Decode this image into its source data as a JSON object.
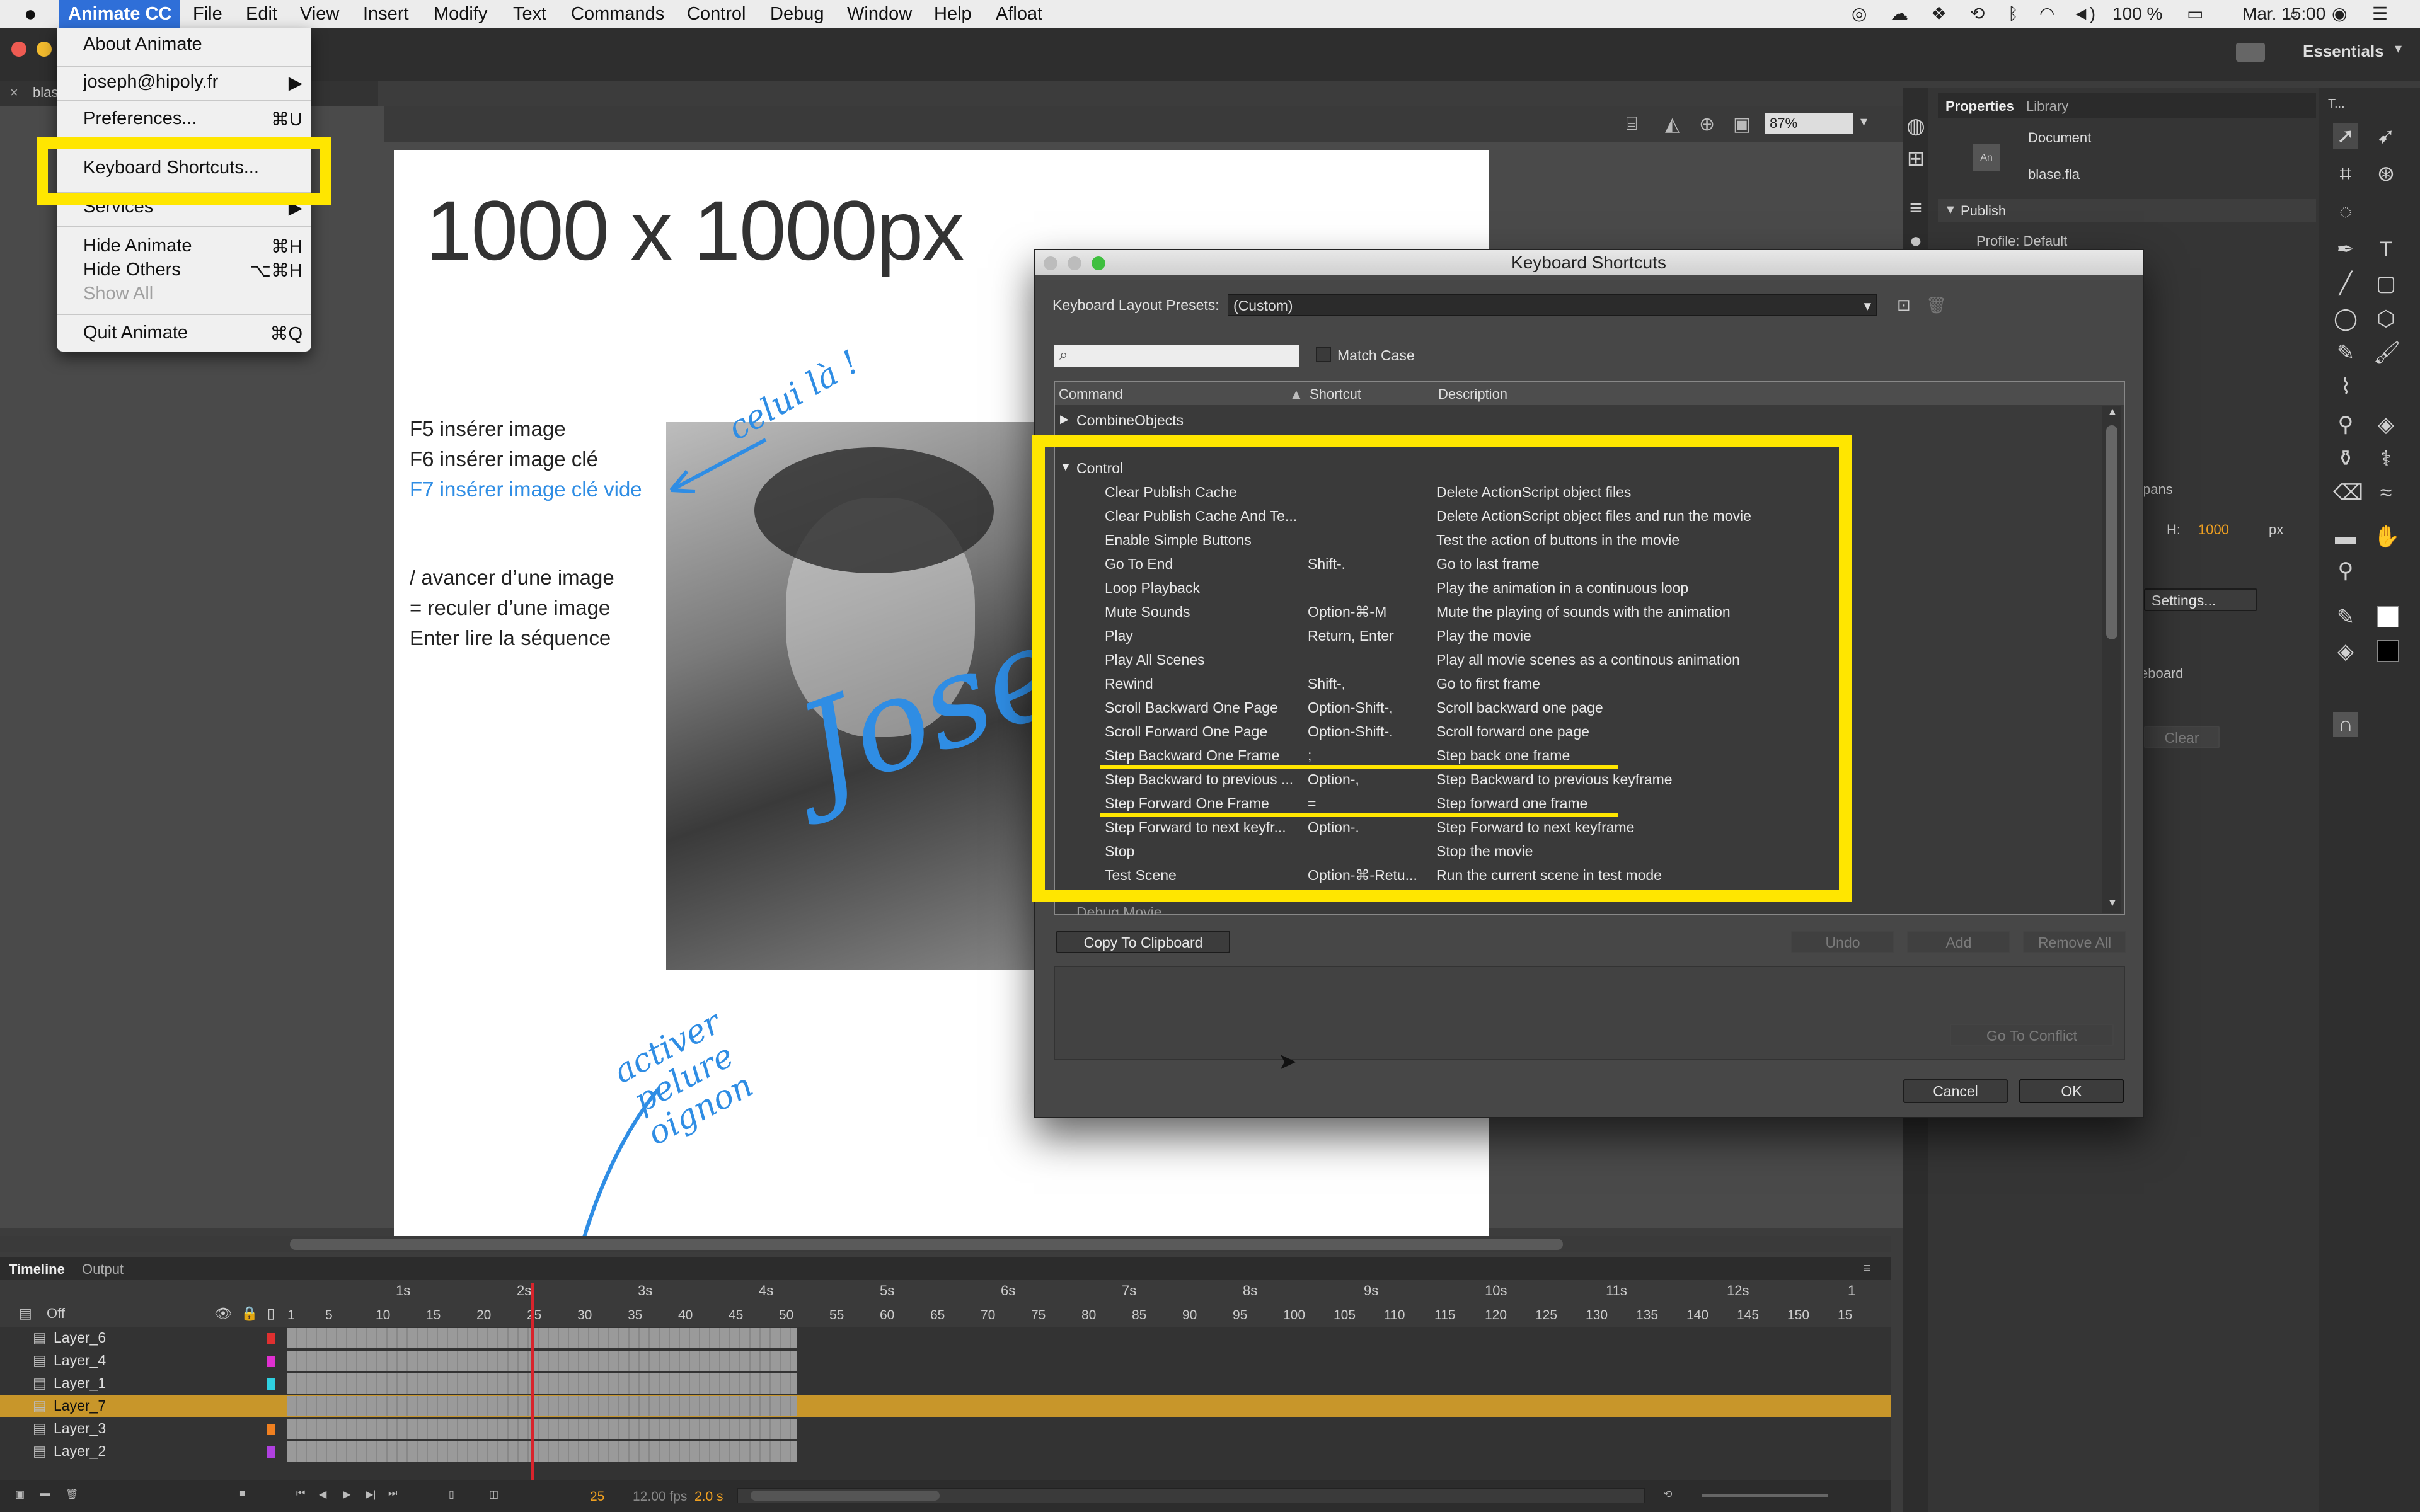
{
  "menubar": {
    "app": "Animate CC",
    "items": [
      "File",
      "Edit",
      "View",
      "Insert",
      "Modify",
      "Text",
      "Commands",
      "Control",
      "Debug",
      "Window",
      "Help",
      "Afloat"
    ],
    "battery": "100 %",
    "clock": "Mar. 15:00"
  },
  "app_menu": {
    "about": "About Animate",
    "account": "joseph@hipoly.fr",
    "preferences": "Preferences...",
    "preferences_key": "⌘U",
    "keyboard_shortcuts": "Keyboard Shortcuts...",
    "services": "Services",
    "hide": "Hide Animate",
    "hide_key": "⌘H",
    "hide_others": "Hide Others",
    "hide_others_key": "⌥⌘H",
    "show_all": "Show All",
    "quit": "Quit Animate",
    "quit_key": "⌘Q"
  },
  "toolbar": {
    "workspace": "Essentials",
    "zoom": "87%",
    "doc_tab": "blas"
  },
  "canvas": {
    "title": "1000 x 1000px",
    "notes": [
      "F5 insérer image",
      "F6 insérer image clé",
      "F7 insérer image clé vide"
    ],
    "notes2": [
      "/ avancer d’une image",
      "= reculer d’une image",
      "Enter lire la séquence"
    ],
    "handwriting_1": "celui là !",
    "handwriting_2": "activer pelure oignon",
    "signature": "Josef"
  },
  "properties": {
    "tabs": [
      "Properties",
      "Library"
    ],
    "doc_type": "Document",
    "file": "blase.fla",
    "section": "Publish",
    "profile": "Profile: Default",
    "h_label": "H:",
    "h_value": "1000",
    "unit": "px",
    "settings": "Settings...",
    "clear": "Clear",
    "partial_1": "pans",
    "partial_2": "eboard"
  },
  "dialog": {
    "title": "Keyboard Shortcuts",
    "preset_label": "Keyboard Layout Presets:",
    "preset_value": "(Custom)",
    "match_case": "Match Case",
    "col_command": "Command",
    "col_shortcut": "Shortcut",
    "col_description": "Description",
    "group_collapsed": "CombineObjects",
    "group_open": "Control",
    "rows": [
      {
        "command": "Clear Publish Cache",
        "shortcut": "",
        "description": "Delete ActionScript object files"
      },
      {
        "command": "Clear Publish Cache And Te...",
        "shortcut": "",
        "description": "Delete ActionScript object files and run the movie"
      },
      {
        "command": "Enable Simple Buttons",
        "shortcut": "",
        "description": "Test the action of buttons in the movie"
      },
      {
        "command": "Go To End",
        "shortcut": "Shift-.",
        "description": "Go to last frame"
      },
      {
        "command": "Loop Playback",
        "shortcut": "",
        "description": "Play the animation in a continuous loop"
      },
      {
        "command": "Mute Sounds",
        "shortcut": "Option-⌘-M",
        "description": "Mute the playing of sounds with the animation"
      },
      {
        "command": "Play",
        "shortcut": "Return, Enter",
        "description": "Play the movie"
      },
      {
        "command": "Play All Scenes",
        "shortcut": "",
        "description": "Play all movie scenes as a continous animation"
      },
      {
        "command": "Rewind",
        "shortcut": "Shift-,",
        "description": "Go to first frame"
      },
      {
        "command": "Scroll Backward One Page",
        "shortcut": "Option-Shift-,",
        "description": "Scroll backward one page"
      },
      {
        "command": "Scroll Forward One Page",
        "shortcut": "Option-Shift-.",
        "description": "Scroll forward one page"
      },
      {
        "command": "Step Backward One Frame",
        "shortcut": ";",
        "description": "Step back one frame"
      },
      {
        "command": "Step Backward to previous ...",
        "shortcut": "Option-,",
        "description": "Step Backward to previous keyframe"
      },
      {
        "command": "Step Forward One Frame",
        "shortcut": "=",
        "description": "Step forward one frame"
      },
      {
        "command": "Step Forward to next keyfr...",
        "shortcut": "Option-.",
        "description": "Step Forward to next keyframe"
      },
      {
        "command": "Stop",
        "shortcut": "",
        "description": "Stop the movie"
      },
      {
        "command": "Test Scene",
        "shortcut": "Option-⌘-Retu...",
        "description": "Run the current scene in test mode"
      }
    ],
    "group_partial": "Debug Movie",
    "copy": "Copy To Clipboard",
    "undo": "Undo",
    "add": "Add",
    "remove_all": "Remove All",
    "goto_conflict": "Go To Conflict",
    "cancel": "Cancel",
    "ok": "OK"
  },
  "timeline": {
    "tabs": [
      "Timeline",
      "Output"
    ],
    "off": "Off",
    "seconds": [
      "1s",
      "2s",
      "3s",
      "4s",
      "5s",
      "6s",
      "7s",
      "8s",
      "9s",
      "10s",
      "11s",
      "12s",
      "1"
    ],
    "frames": [
      "1",
      "5",
      "10",
      "15",
      "20",
      "25",
      "30",
      "35",
      "40",
      "45",
      "50",
      "55",
      "60",
      "65",
      "70",
      "75",
      "80",
      "85",
      "90",
      "95",
      "100",
      "105",
      "110",
      "115",
      "120",
      "125",
      "130",
      "135",
      "140",
      "145",
      "150",
      "15"
    ],
    "layers": [
      "Layer_6",
      "Layer_4",
      "Layer_1",
      "Layer_7",
      "Layer_3",
      "Layer_2"
    ],
    "current_frame": "25",
    "fps": "12.00 fps",
    "time": "2.0 s"
  },
  "colors": {
    "highlight": "#ffe600",
    "accent_blue": "#2f8de4",
    "menu_blue": "#2f6fd8",
    "selected_layer": "#c8962a"
  }
}
